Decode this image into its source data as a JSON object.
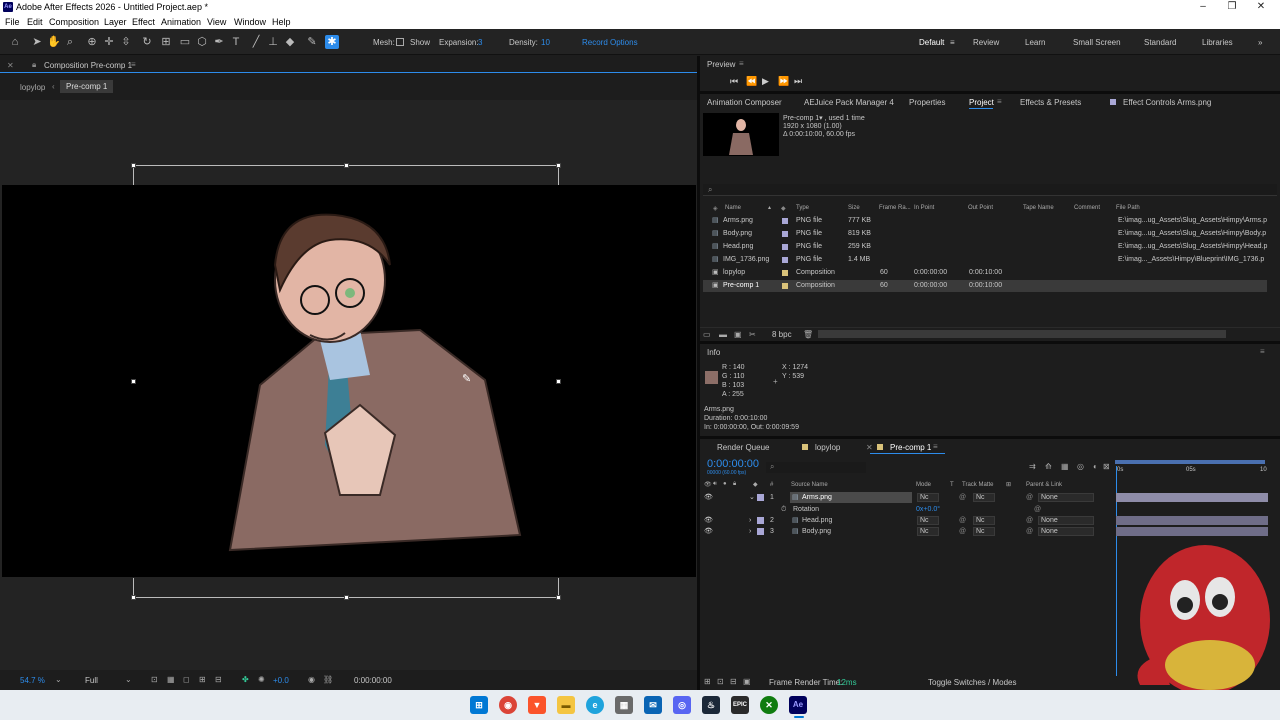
{
  "app": {
    "icon": "Ae",
    "title": "Adobe After Effects 2026 - Untitled Project.aep *"
  },
  "window_controls": {
    "minimize": "–",
    "restore": "❐",
    "close": "✕"
  },
  "menu": [
    "File",
    "Edit",
    "Composition",
    "Layer",
    "Effect",
    "Animation",
    "View",
    "Window",
    "Help"
  ],
  "toolbar": {
    "mesh_label": "Mesh:",
    "show_label": "Show",
    "expansion_label": "Expansion:",
    "expansion_value": "3",
    "density_label": "Density:",
    "density_value": "10",
    "record_options": "Record Options"
  },
  "workspaces": [
    "Default",
    "Review",
    "Learn",
    "Small Screen",
    "Standard",
    "Libraries"
  ],
  "comp_panel": {
    "title": "Composition Pre-comp 1",
    "breadcrumb": [
      "lopylop",
      "Pre-comp 1"
    ],
    "zoom": "54.7 %",
    "resolution": "Full",
    "exposure": "+0.0",
    "timecode": "0:00:00:00"
  },
  "preview": {
    "title": "Preview"
  },
  "project_tabs": [
    "Animation Composer",
    "AEJuice Pack Manager 4",
    "Properties",
    "Project",
    "Effects & Presets",
    "Effect Controls Arms.png"
  ],
  "project_info": {
    "name": "Pre-comp 1▾ , used 1 time",
    "dims": "1920 x 1080 (1.00)",
    "duration": "Δ 0:00:10:00, 60.00 fps"
  },
  "project_columns": [
    "Name",
    "Type",
    "Size",
    "Frame Ra...",
    "In Point",
    "Out Point",
    "Tape Name",
    "Comment",
    "File Path"
  ],
  "project_items": [
    {
      "name": "Arms.png",
      "type": "PNG file",
      "size": "777 KB",
      "fps": "",
      "in": "",
      "out": "",
      "path": "E:\\imag...ug_Assets\\Slug_Assets\\Himpy\\Arms.p",
      "color": "#a9a7d6"
    },
    {
      "name": "Body.png",
      "type": "PNG file",
      "size": "819 KB",
      "fps": "",
      "in": "",
      "out": "",
      "path": "E:\\imag...ug_Assets\\Slug_Assets\\Himpy\\Body.p",
      "color": "#a9a7d6"
    },
    {
      "name": "Head.png",
      "type": "PNG file",
      "size": "259 KB",
      "fps": "",
      "in": "",
      "out": "",
      "path": "E:\\imag...ug_Assets\\Slug_Assets\\Himpy\\Head.p",
      "color": "#a9a7d6"
    },
    {
      "name": "IMG_1736.png",
      "type": "PNG file",
      "size": "1.4 MB",
      "fps": "",
      "in": "",
      "out": "",
      "path": "E:\\imag..._Assets\\Himpy\\Blueprint\\IMG_1736.p",
      "color": "#a9a7d6"
    },
    {
      "name": "lopylop",
      "type": "Composition",
      "size": "",
      "fps": "60",
      "in": "0:00:00:00",
      "out": "0:00:10:00",
      "path": "",
      "color": "#d9c27a"
    },
    {
      "name": "Pre-comp 1",
      "type": "Composition",
      "size": "",
      "fps": "60",
      "in": "0:00:00:00",
      "out": "0:00:10:00",
      "path": "",
      "color": "#d9c27a"
    }
  ],
  "project_footer": {
    "bpc": "8 bpc"
  },
  "info": {
    "title": "Info",
    "r": "R : 140",
    "g": "G : 110",
    "b": "B : 103",
    "a": "A : 255",
    "x": "X : 1274",
    "y": "Y : 539",
    "swatch": "#8c6e67",
    "layer": "Arms.png",
    "duration": "Duration: 0:00:10:00",
    "inout": "In: 0:00:00:00, Out: 0:00:09:59"
  },
  "timeline": {
    "tabs": [
      "Render Queue",
      "lopylop",
      "Pre-comp 1"
    ],
    "timecode": "0:00:00:00",
    "subtimecode": "00000 (60.00 fps)",
    "ruler": [
      "0s",
      "05s",
      "10"
    ],
    "columns": {
      "num": "#",
      "source": "Source Name",
      "mode": "Mode",
      "t": "T",
      "track": "Track Matte",
      "parent": "Parent & Link"
    },
    "layers": [
      {
        "num": "1",
        "name": "Arms.png",
        "mode": "Nc",
        "track": "Nc",
        "parent": "None"
      },
      {
        "num": "2",
        "name": "Head.png",
        "mode": "Nc",
        "track": "Nc",
        "parent": "None"
      },
      {
        "num": "3",
        "name": "Body.png",
        "mode": "Nc",
        "track": "Nc",
        "parent": "None"
      }
    ],
    "rotation_label": "Rotation",
    "rotation_value": "0x+0.0°",
    "render_time_label": "Frame Render Time:",
    "render_time_value": "12ms",
    "toggle": "Toggle Switches / Modes"
  },
  "taskbar": [
    "windows-start",
    "chrome",
    "brave",
    "file-explorer",
    "edge",
    "microsoft-store",
    "mail",
    "discord",
    "steam",
    "epic-games",
    "xbox",
    "after-effects"
  ]
}
